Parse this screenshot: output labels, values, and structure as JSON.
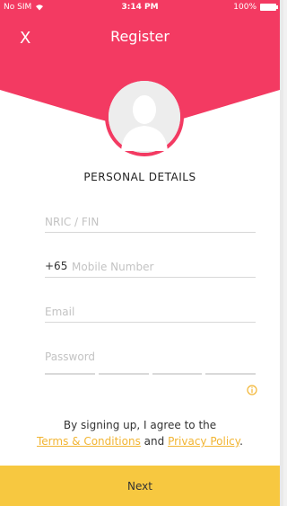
{
  "statusbar": {
    "carrier": "No SIM",
    "time": "3:14 PM",
    "battery": "100%"
  },
  "header": {
    "close_label": "X",
    "title": "Register"
  },
  "section_title": "PERSONAL DETAILS",
  "form": {
    "nric_placeholder": "NRIC / FIN",
    "mobile_prefix": "+65",
    "mobile_placeholder": "Mobile Number",
    "email_placeholder": "Email",
    "password_placeholder": "Password"
  },
  "terms": {
    "line1": "By signing up, I agree to the",
    "terms_link": "Terms & Conditions",
    "and": "and",
    "privacy_link": "Privacy Policy",
    "period": "."
  },
  "next_label": "Next",
  "colors": {
    "brand_pink": "#f33a62",
    "accent_yellow": "#f7c840",
    "link": "#f2b533"
  },
  "icons": {
    "close": "close-icon",
    "avatar": "user-avatar-icon",
    "info": "info-icon",
    "wifi": "wifi-icon",
    "battery": "battery-icon"
  }
}
